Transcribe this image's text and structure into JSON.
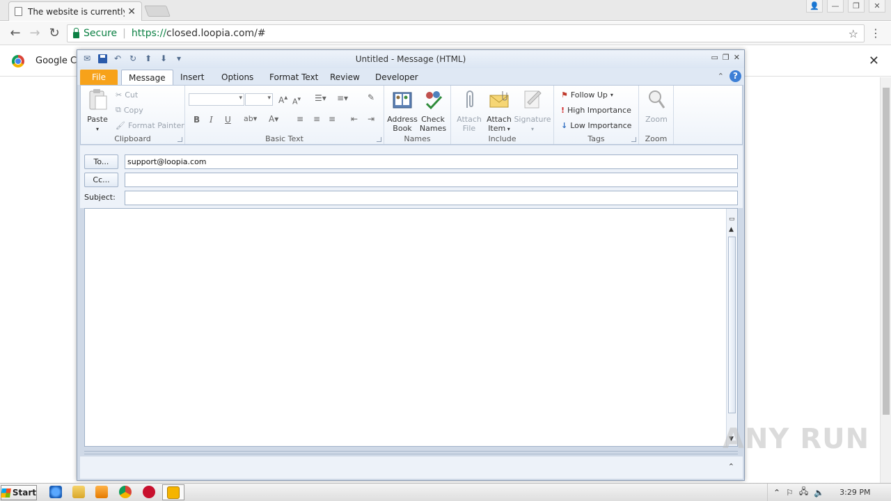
{
  "browser": {
    "tab_title": "The website is currently not",
    "secure_label": "Secure",
    "url_proto": "https://",
    "url_rest": "closed.loopia.com/#",
    "infobar_text": "Google Chr"
  },
  "outlook": {
    "window_title": "Untitled - Message (HTML)",
    "tabs": [
      "File",
      "Message",
      "Insert",
      "Options",
      "Format Text",
      "Review",
      "Developer"
    ],
    "clipboard": {
      "paste": "Paste",
      "cut": "Cut",
      "copy": "Copy",
      "format_painter": "Format Painter",
      "label": "Clipboard"
    },
    "basic_text_label": "Basic Text",
    "names": {
      "address_book_1": "Address",
      "address_book_2": "Book",
      "check_names_1": "Check",
      "check_names_2": "Names",
      "label": "Names"
    },
    "include": {
      "attach_file_1": "Attach",
      "attach_file_2": "File",
      "attach_item_1": "Attach",
      "attach_item_2": "Item",
      "signature": "Signature",
      "label": "Include"
    },
    "tags": {
      "follow_up": "Follow Up",
      "high": "High Importance",
      "low": "Low Importance",
      "label": "Tags"
    },
    "zoom": {
      "button": "Zoom",
      "label": "Zoom"
    },
    "fields": {
      "to_button": "To...",
      "cc_button": "Cc...",
      "subject_label": "Subject:",
      "to_value": "support@loopia.com",
      "cc_value": "",
      "subject_value": ""
    }
  },
  "taskbar": {
    "start": "Start",
    "clock": "3:29 PM"
  },
  "watermark": "ANY RUN",
  "colors": {
    "file_tab": "#f7a21a",
    "secure_green": "#0b8043",
    "ribbon_border": "#b6c5d9"
  }
}
